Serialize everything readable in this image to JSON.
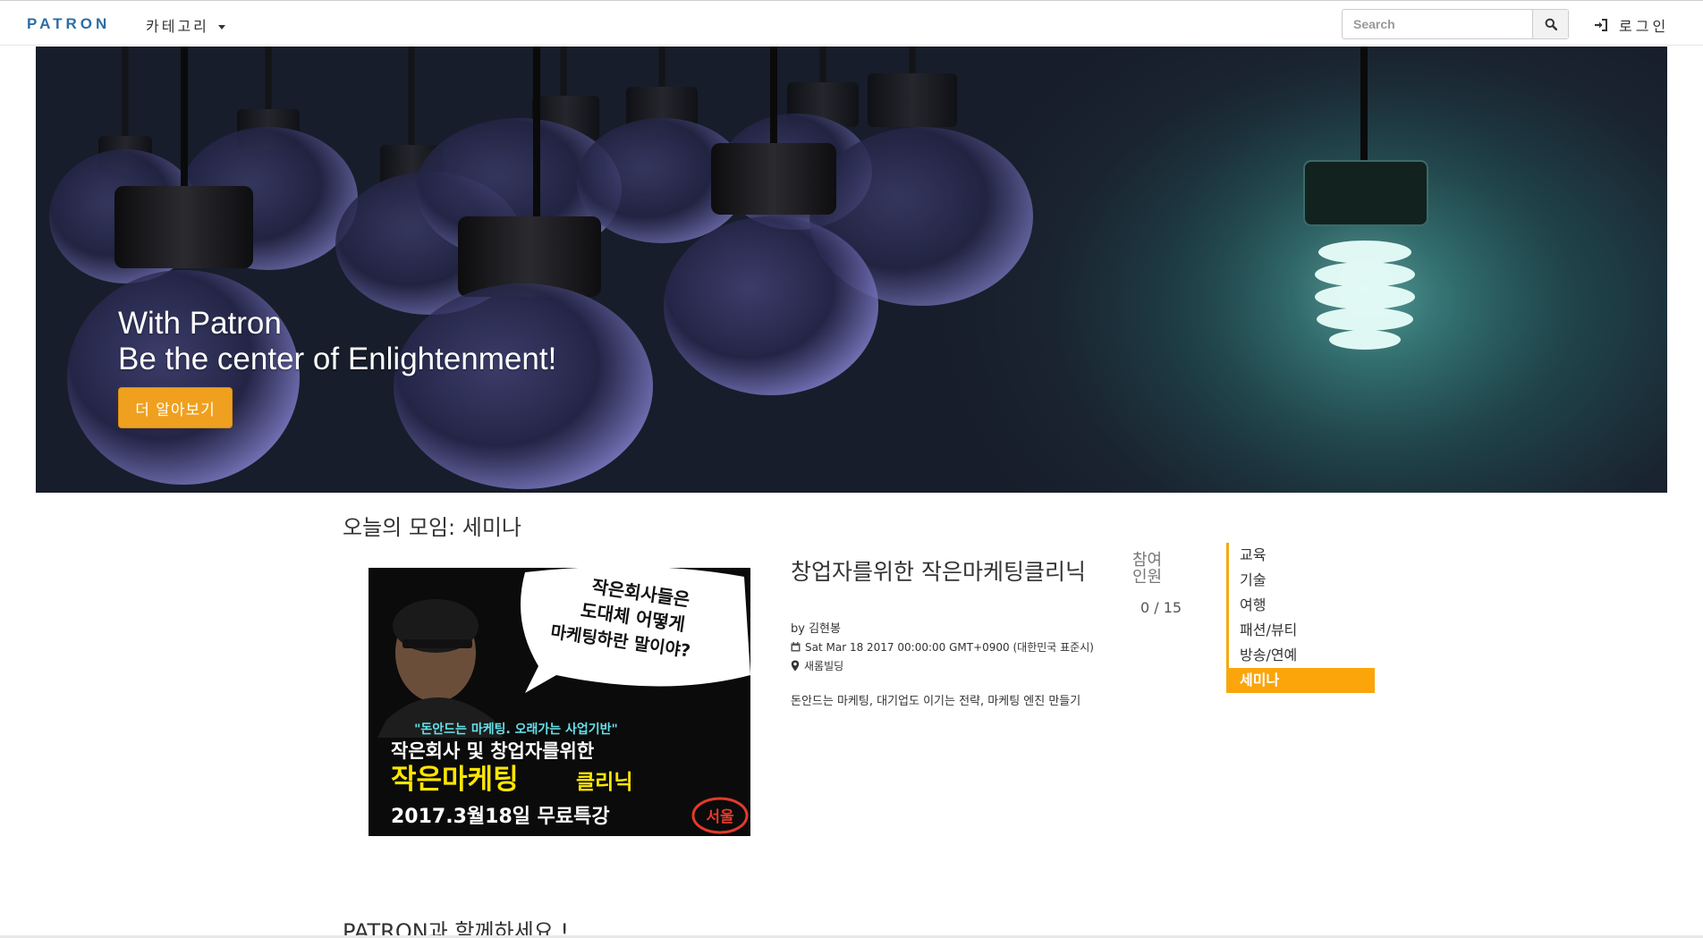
{
  "navbar": {
    "brand": "PATRON",
    "category_label": "카테고리",
    "search_placeholder": "Search",
    "login_label": "로그인"
  },
  "hero": {
    "title_line1": "With Patron",
    "title_line2": "Be the center of Enlightenment!",
    "button_label": "더 알아보기"
  },
  "today": {
    "heading": "오늘의 모임: 세미나",
    "event": {
      "image_text": {
        "bubble_line1": "작은회사들은",
        "bubble_line2": "도대체 어떻게",
        "bubble_line3": "마케팅하란 말이야?",
        "quote": "\"돈안드는 마케팅. 오래가는 사업기반\"",
        "line1": "작은회사 및 창업자를위한",
        "line2_main": "작은마케팅",
        "line2_sub": "클리닉",
        "date_line": "2017.3월18일 무료특강",
        "city": "서울"
      },
      "title": "창업자를위한 작은마케팅클리닉",
      "host": "by 김현봉",
      "date": "Sat Mar 18 2017 00:00:00 GMT+0900 (대한민국 표준시)",
      "place": "새롬빌딩",
      "description": "돈안드는 마케팅, 대기업도 이기는 전략, 마케팅 엔진 만들기",
      "participants_label": "참여인원",
      "participants_count": "0 / 15"
    }
  },
  "categories": [
    {
      "label": "교육",
      "active": false
    },
    {
      "label": "기술",
      "active": false
    },
    {
      "label": "여행",
      "active": false
    },
    {
      "label": "패션/뷰티",
      "active": false
    },
    {
      "label": "방송/연예",
      "active": false
    },
    {
      "label": "세미나",
      "active": true
    }
  ],
  "join_heading": "PATRON과 함께하세요 !",
  "colors": {
    "brand": "#2e6da4",
    "accent_orange": "#f0a01f",
    "active_category": "#fba50b"
  }
}
